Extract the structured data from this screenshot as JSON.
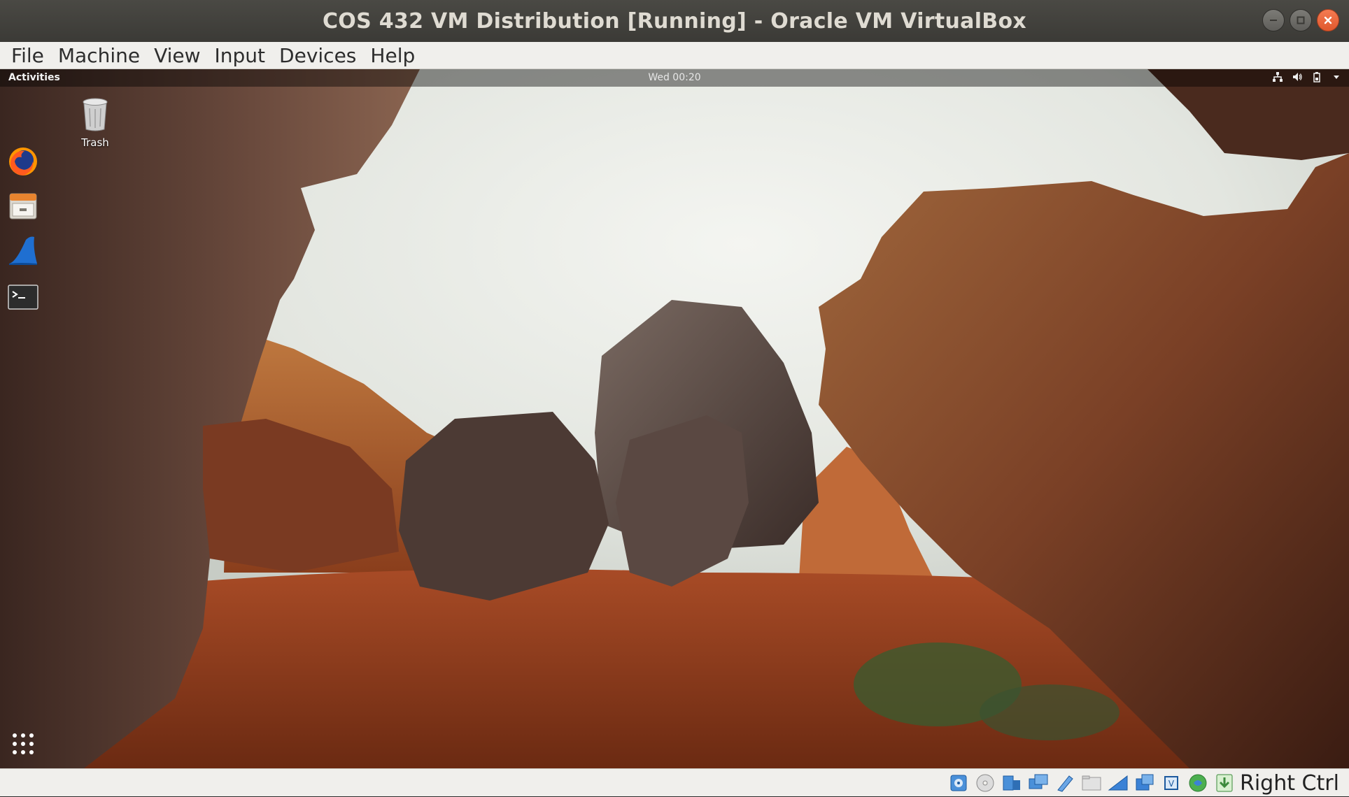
{
  "window": {
    "title": "COS 432 VM Distribution [Running] - Oracle VM VirtualBox",
    "controls": [
      "minimize",
      "maximize",
      "close"
    ]
  },
  "menu": {
    "items": [
      "File",
      "Machine",
      "View",
      "Input",
      "Devices",
      "Help"
    ]
  },
  "guest": {
    "top_bar": {
      "activities": "Activities",
      "clock": "Wed 00:20",
      "tray_icons": [
        "network-icon",
        "volume-icon",
        "battery-icon",
        "dropdown-arrow-icon"
      ]
    },
    "dock": {
      "apps": [
        "firefox-icon",
        "files-icon",
        "wireshark-icon",
        "terminal-icon"
      ],
      "app_grid": "app-grid-icon"
    },
    "desktop": {
      "icons": [
        {
          "label": "Trash",
          "icon": "trash-icon"
        }
      ]
    }
  },
  "statusbar": {
    "icons": [
      "hard-disk-icon",
      "optical-disk-icon",
      "audio-icon",
      "network-icon",
      "usb-icon",
      "shared-folders-icon",
      "display-icon",
      "recording-icon",
      "cpu-icon",
      "mouse-integration-icon",
      "keyboard-icon"
    ],
    "host_key": "Right Ctrl"
  },
  "colors": {
    "titlebar": "#3f3e3a",
    "close_button": "#e9643a",
    "menubar": "#f0efec"
  }
}
